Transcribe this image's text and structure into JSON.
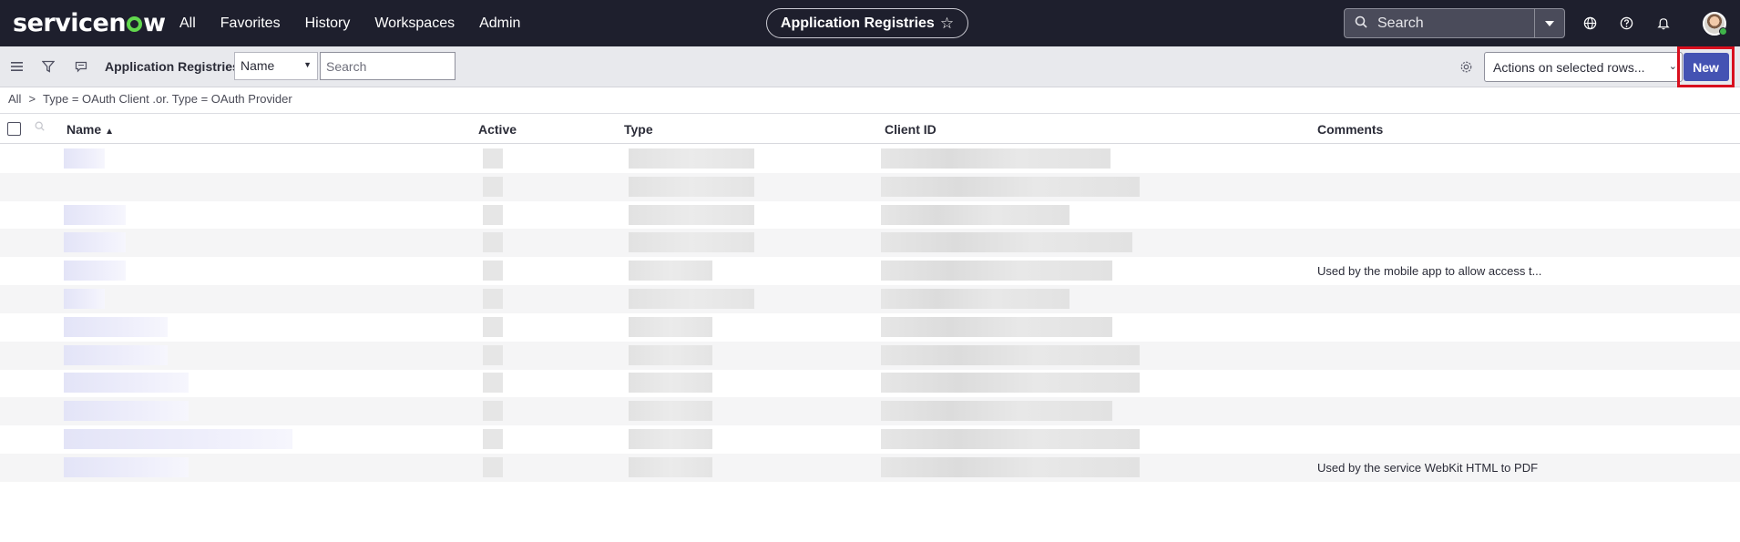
{
  "topnav": {
    "logo_prefix": "servicen",
    "logo_suffix": "w",
    "links": [
      "All",
      "Favorites",
      "History",
      "Workspaces",
      "Admin"
    ],
    "app_title": "Application Registries",
    "star_glyph": "☆",
    "search_placeholder": "Search",
    "icons": [
      "globe-icon",
      "help-icon",
      "bell-icon"
    ]
  },
  "toolbar": {
    "list_title": "Application Registries",
    "field_select": "Name",
    "search_placeholder": "Search",
    "actions_select": "Actions on selected rows...",
    "new_label": "New"
  },
  "breadcrumb": {
    "root": "All",
    "separator": ">",
    "filter": "Type = OAuth Client .or. Type = OAuth Provider"
  },
  "table": {
    "columns": [
      "Name",
      "Active",
      "Type",
      "Client ID",
      "Comments"
    ],
    "sort_glyph": "▲",
    "rows": [
      {
        "comment": ""
      },
      {
        "comment": ""
      },
      {
        "comment": ""
      },
      {
        "comment": ""
      },
      {
        "comment": "Used by the mobile app to allow access t..."
      },
      {
        "comment": ""
      },
      {
        "comment": ""
      },
      {
        "comment": ""
      },
      {
        "comment": ""
      },
      {
        "comment": ""
      },
      {
        "comment": ""
      },
      {
        "comment": "Used by the service WebKit HTML to PDF"
      }
    ]
  },
  "colors": {
    "nav_bg": "#1e1f2d",
    "accent": "#4453b3",
    "highlight": "#d80f1e",
    "logo_green": "#62d84e"
  }
}
